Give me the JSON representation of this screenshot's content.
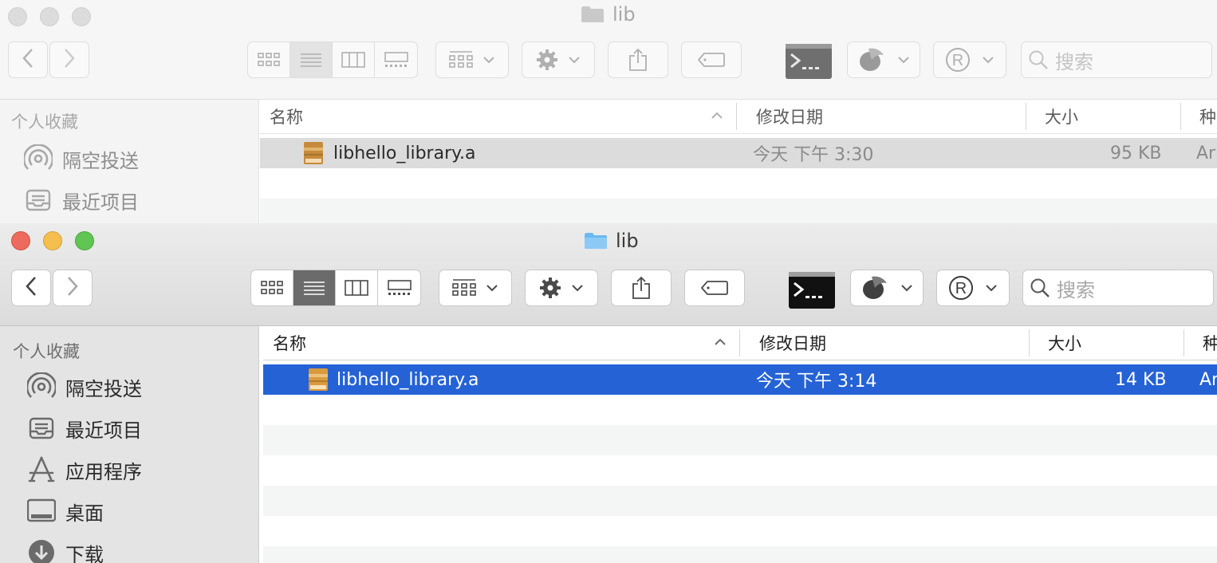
{
  "colors": {
    "selection_active": "#2462d6",
    "selection_inactive": "#dcdcdc",
    "folder": "#6cb7f0",
    "archive": "#d99a3f"
  },
  "back_window": {
    "title": "lib",
    "search_placeholder": "搜索",
    "sidebar": {
      "section": "个人收藏",
      "items": [
        {
          "label": "隔空投送",
          "icon": "airdrop-icon"
        },
        {
          "label": "最近项目",
          "icon": "recents-icon"
        }
      ]
    },
    "columns": {
      "name": "名称",
      "date": "修改日期",
      "size": "大小",
      "kind": "种"
    },
    "files": [
      {
        "name": "libhello_library.a",
        "date": "今天 下午 3:30",
        "size": "95 KB",
        "kind": "Ar"
      }
    ]
  },
  "front_window": {
    "title": "lib",
    "search_placeholder": "搜索",
    "sidebar": {
      "section": "个人收藏",
      "items": [
        {
          "label": "隔空投送",
          "icon": "airdrop-icon"
        },
        {
          "label": "最近项目",
          "icon": "recents-icon"
        },
        {
          "label": "应用程序",
          "icon": "applications-icon"
        },
        {
          "label": "桌面",
          "icon": "desktop-icon"
        },
        {
          "label": "下载",
          "icon": "downloads-icon"
        }
      ]
    },
    "columns": {
      "name": "名称",
      "date": "修改日期",
      "size": "大小",
      "kind": "种"
    },
    "files": [
      {
        "name": "libhello_library.a",
        "date": "今天 下午 3:14",
        "size": "14 KB",
        "kind": "Ar"
      }
    ]
  }
}
